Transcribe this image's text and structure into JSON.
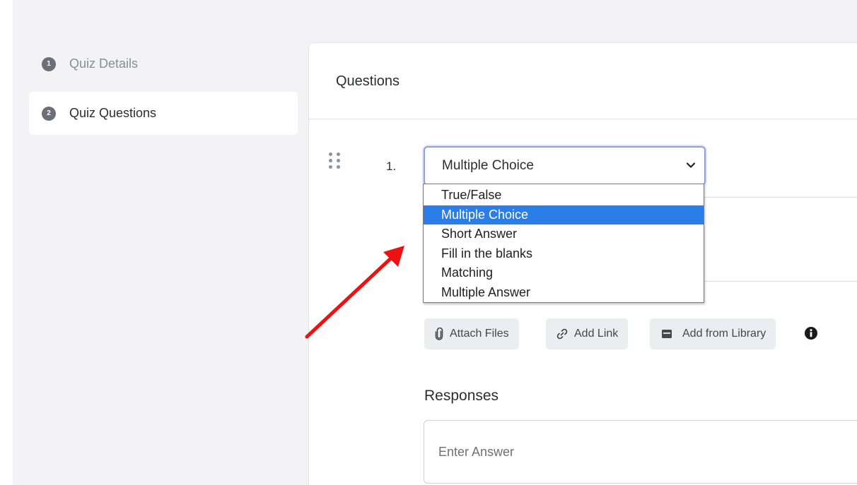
{
  "sidebar": {
    "steps": [
      {
        "number": "1",
        "label": "Quiz Details",
        "active": false
      },
      {
        "number": "2",
        "label": "Quiz Questions",
        "active": true
      }
    ]
  },
  "card": {
    "title": "Questions"
  },
  "question": {
    "number": "1.",
    "type_select": {
      "value": "Multiple Choice",
      "options": [
        "True/False",
        "Multiple Choice",
        "Short Answer",
        "Fill in the blanks",
        "Matching",
        "Multiple Answer"
      ],
      "selected_index": 1
    }
  },
  "attachments": {
    "attach_files": "Attach Files",
    "add_link": "Add Link",
    "add_from_library": "Add from Library",
    "info_icon": "info-icon"
  },
  "responses": {
    "title": "Responses",
    "answer_placeholder": "Enter Answer"
  },
  "colors": {
    "selected_option": "#2b7de9",
    "annotation_arrow": "#ee1111",
    "focus_border": "#8fa0dc"
  }
}
